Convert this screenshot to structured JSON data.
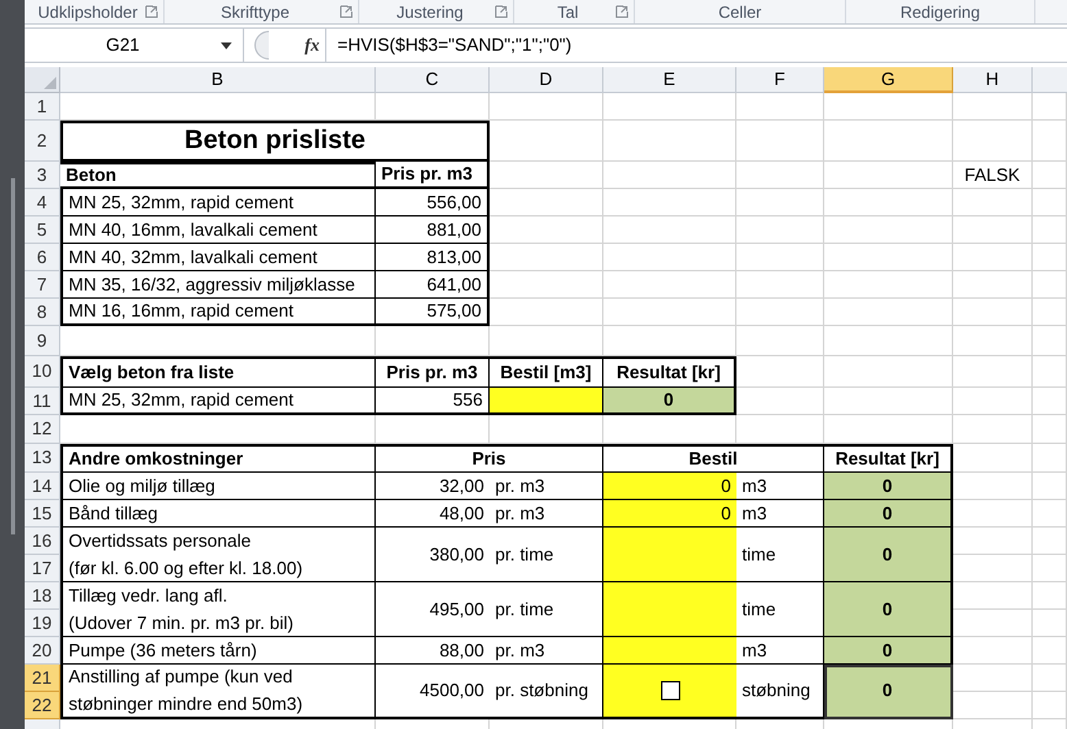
{
  "ribbon_groups": [
    {
      "label": "Udklipsholder",
      "launcher": true
    },
    {
      "label": "Skrifttype",
      "launcher": true
    },
    {
      "label": "Justering",
      "launcher": true
    },
    {
      "label": "Tal",
      "launcher": true
    },
    {
      "label": "Celler",
      "launcher": false
    },
    {
      "label": "Redigering",
      "launcher": false
    }
  ],
  "formula_bar": {
    "name_box": "G21",
    "function_label": "fx",
    "formula": "=HVIS($H$3=\"SAND\";\"1\";\"0\")"
  },
  "column_headers": [
    {
      "label": "B",
      "selected": false
    },
    {
      "label": "C",
      "selected": false
    },
    {
      "label": "D",
      "selected": false
    },
    {
      "label": "E",
      "selected": false
    },
    {
      "label": "F",
      "selected": false
    },
    {
      "label": "G",
      "selected": true
    },
    {
      "label": "H",
      "selected": false
    }
  ],
  "row_headers": [
    {
      "label": "1",
      "selected": false
    },
    {
      "label": "2",
      "selected": false
    },
    {
      "label": "3",
      "selected": false
    },
    {
      "label": "4",
      "selected": false
    },
    {
      "label": "5",
      "selected": false
    },
    {
      "label": "6",
      "selected": false
    },
    {
      "label": "7",
      "selected": false
    },
    {
      "label": "8",
      "selected": false
    },
    {
      "label": "9",
      "selected": false
    },
    {
      "label": "10",
      "selected": false
    },
    {
      "label": "11",
      "selected": false
    },
    {
      "label": "12",
      "selected": false
    },
    {
      "label": "13",
      "selected": false
    },
    {
      "label": "14",
      "selected": false
    },
    {
      "label": "15",
      "selected": false
    },
    {
      "label": "16",
      "selected": false
    },
    {
      "label": "17",
      "selected": false
    },
    {
      "label": "18",
      "selected": false
    },
    {
      "label": "19",
      "selected": false
    },
    {
      "label": "20",
      "selected": false
    },
    {
      "label": "21",
      "selected": true
    },
    {
      "label": "22",
      "selected": true
    }
  ],
  "price_list": {
    "title": "Beton prisliste",
    "columns": [
      "Beton",
      "Pris pr. m3"
    ],
    "rows": [
      {
        "name": "MN 25, 32mm, rapid cement",
        "price": "556,00"
      },
      {
        "name": "MN 40, 16mm, lavalkali cement",
        "price": "881,00"
      },
      {
        "name": "MN 40, 32mm, lavalkali cement",
        "price": "813,00"
      },
      {
        "name": "MN 35, 16/32, aggressiv miljøklasse",
        "price": "641,00"
      },
      {
        "name": "MN 16, 16mm, rapid cement",
        "price": "575,00"
      }
    ]
  },
  "flag_cell": "FALSK",
  "selection": {
    "columns": [
      "Vælg beton fra liste",
      "Pris pr. m3",
      "Bestil [m3]",
      "Resultat [kr]"
    ],
    "row": {
      "name": "MN 25, 32mm, rapid cement",
      "price": "556",
      "result": "0"
    }
  },
  "other_costs": {
    "columns": [
      "Andre omkostninger",
      "Pris",
      "Bestil",
      "Resultat [kr]"
    ],
    "rows": [
      {
        "lines": [
          "Olie og miljø tillæg"
        ],
        "price": "32,00",
        "unit": "pr. m3",
        "kind": "number",
        "order": "0",
        "order_unit": "m3",
        "result": "0",
        "selected": false
      },
      {
        "lines": [
          "Bånd tillæg"
        ],
        "price": "48,00",
        "unit": "pr. m3",
        "kind": "number",
        "order": "0",
        "order_unit": "m3",
        "result": "0",
        "selected": false
      },
      {
        "lines": [
          "Overtidssats personale",
          "(før kl. 6.00 og efter kl. 18.00)"
        ],
        "price": "380,00",
        "unit": "pr. time",
        "kind": "number",
        "order_unit": "time",
        "result": "0",
        "selected": false
      },
      {
        "lines": [
          "Tillæg vedr. lang afl.",
          "(Udover 7 min. pr. m3 pr. bil)"
        ],
        "price": "495,00",
        "unit": "pr. time",
        "kind": "number",
        "order_unit": "time",
        "result": "0",
        "selected": false
      },
      {
        "lines": [
          "Pumpe (36 meters tårn)"
        ],
        "price": "88,00",
        "unit": "pr. m3",
        "kind": "number",
        "order_unit": "m3",
        "result": "0",
        "selected": false
      },
      {
        "lines": [
          "Anstilling af pumpe (kun ved",
          "støbninger mindre end 50m3)"
        ],
        "price": "4500,00",
        "unit": "pr. støbning",
        "kind": "checkbox",
        "checked": false,
        "order_unit": "støbning",
        "result": "0",
        "selected": true
      }
    ]
  }
}
